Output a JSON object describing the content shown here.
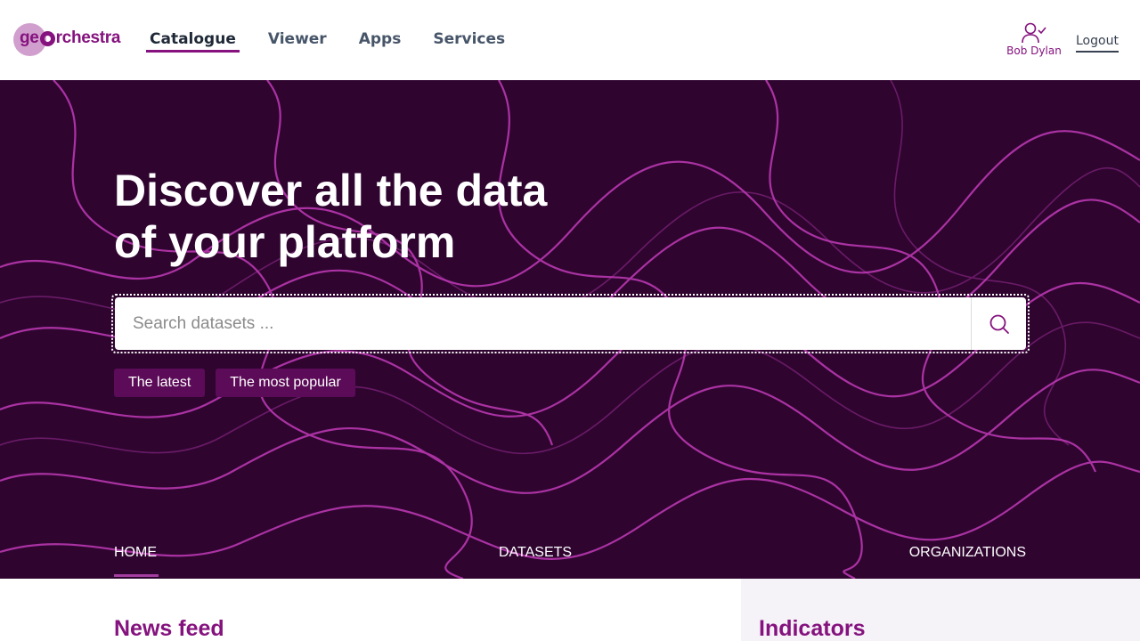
{
  "header": {
    "logo_text": "georchestra",
    "nav": [
      {
        "label": "Catalogue",
        "active": true
      },
      {
        "label": "Viewer",
        "active": false
      },
      {
        "label": "Apps",
        "active": false
      },
      {
        "label": "Services",
        "active": false
      }
    ],
    "user_name": "Bob Dylan",
    "logout_label": "Logout",
    "icons": {
      "user": "user-check-icon"
    }
  },
  "hero": {
    "title_line1": "Discover all the data",
    "title_line2": "of your platform",
    "search": {
      "placeholder": "Search datasets ...",
      "value": "",
      "icon": "search-icon"
    },
    "chips": [
      "The latest",
      "The most popular"
    ]
  },
  "subnav": {
    "items": [
      {
        "label": "HOME",
        "active": true
      },
      {
        "label": "DATASETS",
        "active": false
      },
      {
        "label": "ORGANIZATIONS",
        "active": false
      }
    ]
  },
  "sections": {
    "news_title": "News feed",
    "indicators_title": "Indicators"
  },
  "colors": {
    "brand": "#85127e",
    "hero_bg": "#2f0530",
    "chip_bg": "#5b0b57",
    "wave": "#c13ab8"
  }
}
